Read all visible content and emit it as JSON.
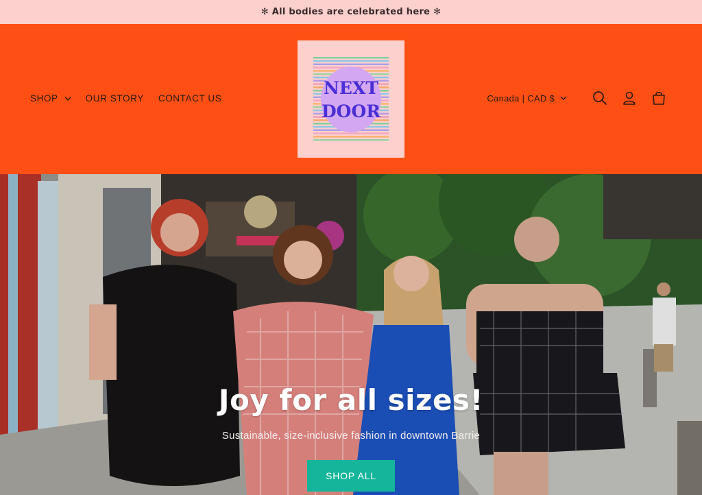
{
  "announcement": {
    "text": "✻ All bodies are celebrated here ✻"
  },
  "header": {
    "nav": [
      {
        "label": "SHOP",
        "has_dropdown": true
      },
      {
        "label": "OUR STORY",
        "has_dropdown": false
      },
      {
        "label": "CONTACT US",
        "has_dropdown": false
      }
    ],
    "logo": {
      "line1": "NEXT",
      "line2": "DOOR"
    },
    "country_selector": "Canada | CAD $",
    "icons": [
      "search-icon",
      "account-icon",
      "cart-icon"
    ]
  },
  "hero": {
    "title": "Joy for all sizes!",
    "subtitle": "Sustainable, size-inclusive fashion in downtown Barrie",
    "button_label": "SHOP ALL"
  },
  "colors": {
    "announcement_bg": "#fbd0cd",
    "header_bg": "#fe5014",
    "button_bg": "#14b59b",
    "logo_circle": "#d3a7f2",
    "logo_text": "#4a2fd6"
  }
}
